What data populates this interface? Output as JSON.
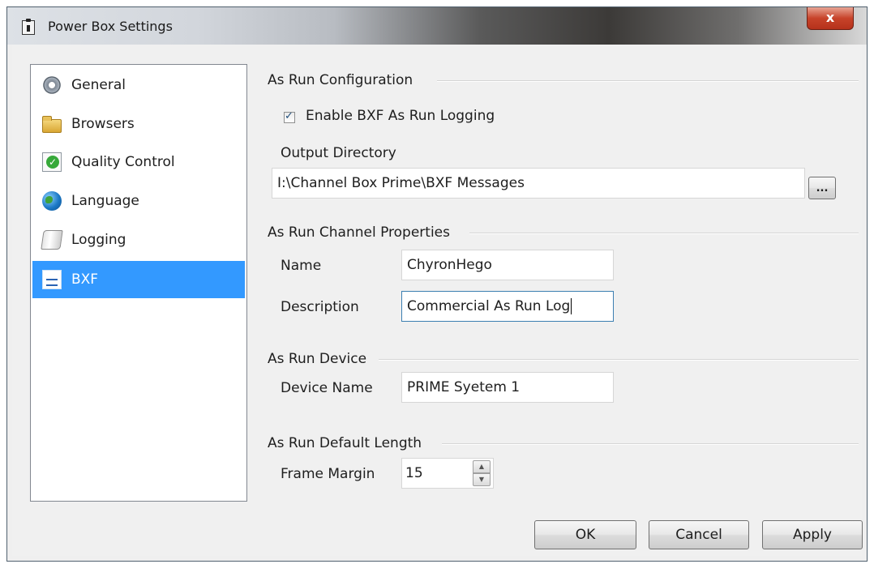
{
  "window": {
    "title": "Power Box Settings",
    "close_label": "x"
  },
  "nav": {
    "items": [
      {
        "label": "General",
        "icon": "gear-icon"
      },
      {
        "label": "Browsers",
        "icon": "folder-icon"
      },
      {
        "label": "Quality Control",
        "icon": "quality-check-icon"
      },
      {
        "label": "Language",
        "icon": "globe-icon"
      },
      {
        "label": "Logging",
        "icon": "scroll-icon"
      },
      {
        "label": "BXF",
        "icon": "bxf-document-icon",
        "selected": true
      }
    ]
  },
  "as_run_configuration": {
    "title": "As Run Configuration",
    "enable_label": "Enable BXF As Run Logging",
    "enable_checked": true,
    "output_dir_label": "Output Directory",
    "output_dir_value": "I:\\Channel Box Prime\\BXF Messages",
    "browse_label": "..."
  },
  "channel_properties": {
    "title": "As Run Channel Properties",
    "name_label": "Name",
    "name_value": "ChyronHego",
    "description_label": "Description",
    "description_value": "Commercial As Run Log"
  },
  "device": {
    "title": "As Run Device",
    "device_name_label": "Device Name",
    "device_name_value": "PRIME Syetem 1"
  },
  "default_length": {
    "title": "As Run Default Length",
    "frame_margin_label": "Frame Margin",
    "frame_margin_value": "15"
  },
  "buttons": {
    "ok": "OK",
    "cancel": "Cancel",
    "apply": "Apply"
  },
  "colors": {
    "selection": "#3399ff",
    "close_button": "#c7432a"
  }
}
